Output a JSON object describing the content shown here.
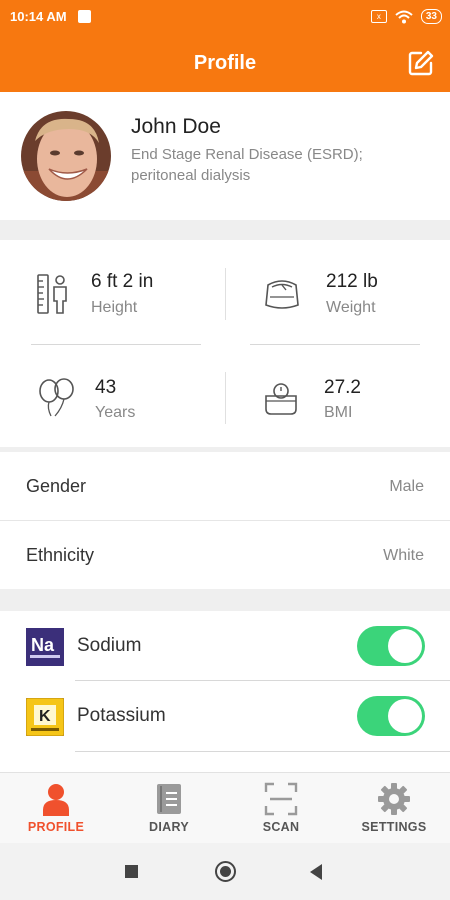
{
  "status_bar": {
    "time": "10:14 AM",
    "sim_icon": "x",
    "battery": "33"
  },
  "header": {
    "title": "Profile",
    "edit_icon": "edit-icon"
  },
  "profile": {
    "name": "John Doe",
    "condition": "End Stage Renal Disease (ESRD); peritoneal dialysis"
  },
  "stats": {
    "height": {
      "value": "6 ft 2 in",
      "label": "Height",
      "icon": "ruler-person-icon"
    },
    "weight": {
      "value": "212 lb",
      "label": "Weight",
      "icon": "scale-icon"
    },
    "age": {
      "value": "43",
      "label": "Years",
      "icon": "balloons-icon"
    },
    "bmi": {
      "value": "27.2",
      "label": "BMI",
      "icon": "bmi-scale-icon"
    }
  },
  "details": {
    "gender": {
      "label": "Gender",
      "value": "Male"
    },
    "ethnicity": {
      "label": "Ethnicity",
      "value": "White"
    }
  },
  "minerals": [
    {
      "label": "Sodium",
      "symbol": "Na",
      "enabled": true,
      "badge_color": "#3b2f7a"
    },
    {
      "label": "Potassium",
      "symbol": "K",
      "enabled": true,
      "badge_color": "#f5c518"
    }
  ],
  "tabs": [
    {
      "label": "PROFILE",
      "icon": "person-icon",
      "active": true
    },
    {
      "label": "DIARY",
      "icon": "diary-icon",
      "active": false
    },
    {
      "label": "SCAN",
      "icon": "scan-icon",
      "active": false
    },
    {
      "label": "SETTINGS",
      "icon": "gear-icon",
      "active": false
    }
  ],
  "colors": {
    "accent": "#f77810",
    "active_tab": "#f0512d",
    "toggle_on": "#3bd47a"
  }
}
